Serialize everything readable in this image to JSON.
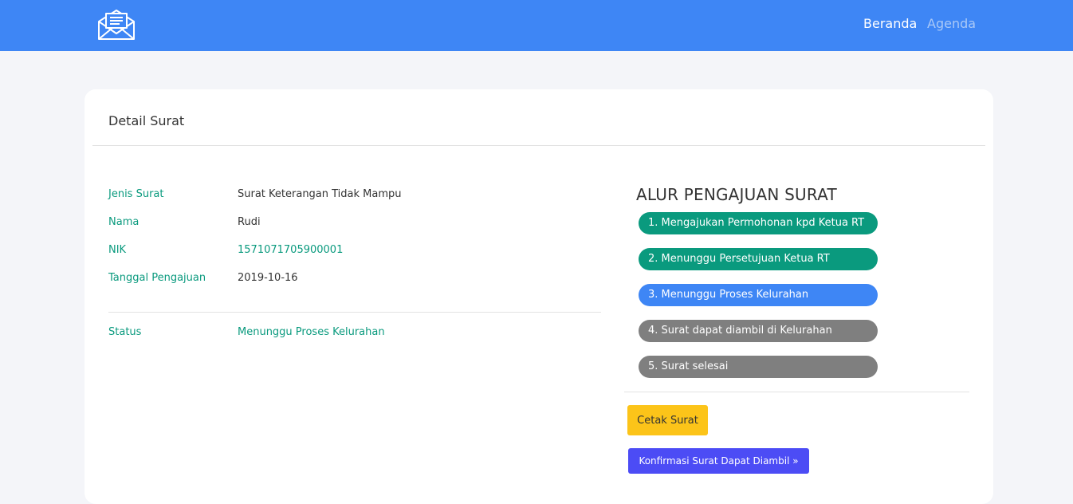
{
  "nav": {
    "logo_icon": "envelope-icon",
    "links": [
      {
        "label": "Beranda",
        "active": true
      },
      {
        "label": "Agenda",
        "active": false
      }
    ]
  },
  "card": {
    "title": "Detail Surat",
    "details": [
      {
        "label": "Jenis Surat",
        "value": "Surat Keterangan Tidak Mampu"
      },
      {
        "label": "Nama",
        "value": "Rudi"
      },
      {
        "label": "NIK",
        "value": "1571071705900001"
      },
      {
        "label": "Tanggal Pengajuan",
        "value": "2019-10-16"
      }
    ],
    "status": {
      "label": "Status",
      "value": "Menunggu Proses Kelurahan"
    }
  },
  "alur": {
    "title": "ALUR PENGAJUAN SURAT",
    "steps": [
      {
        "label": "1. Mengajukan Permohonan kpd Ketua RT",
        "state": "done"
      },
      {
        "label": "2. Menunggu Persetujuan Ketua RT",
        "state": "done"
      },
      {
        "label": "3. Menunggu Proses Kelurahan",
        "state": "active"
      },
      {
        "label": "4. Surat dapat diambil di Kelurahan",
        "state": "pending"
      },
      {
        "label": "5. Surat selesai",
        "state": "pending"
      }
    ]
  },
  "actions": {
    "cetak_label": "Cetak Surat",
    "konfirmasi_label": "Konfirmasi Surat Dapat Diambil »"
  },
  "colors": {
    "primary": "#3e86f5",
    "success": "#0a9a7e",
    "muted": "#7f7f7f",
    "warning": "#fcc419",
    "indigo": "#4c4cf5"
  }
}
